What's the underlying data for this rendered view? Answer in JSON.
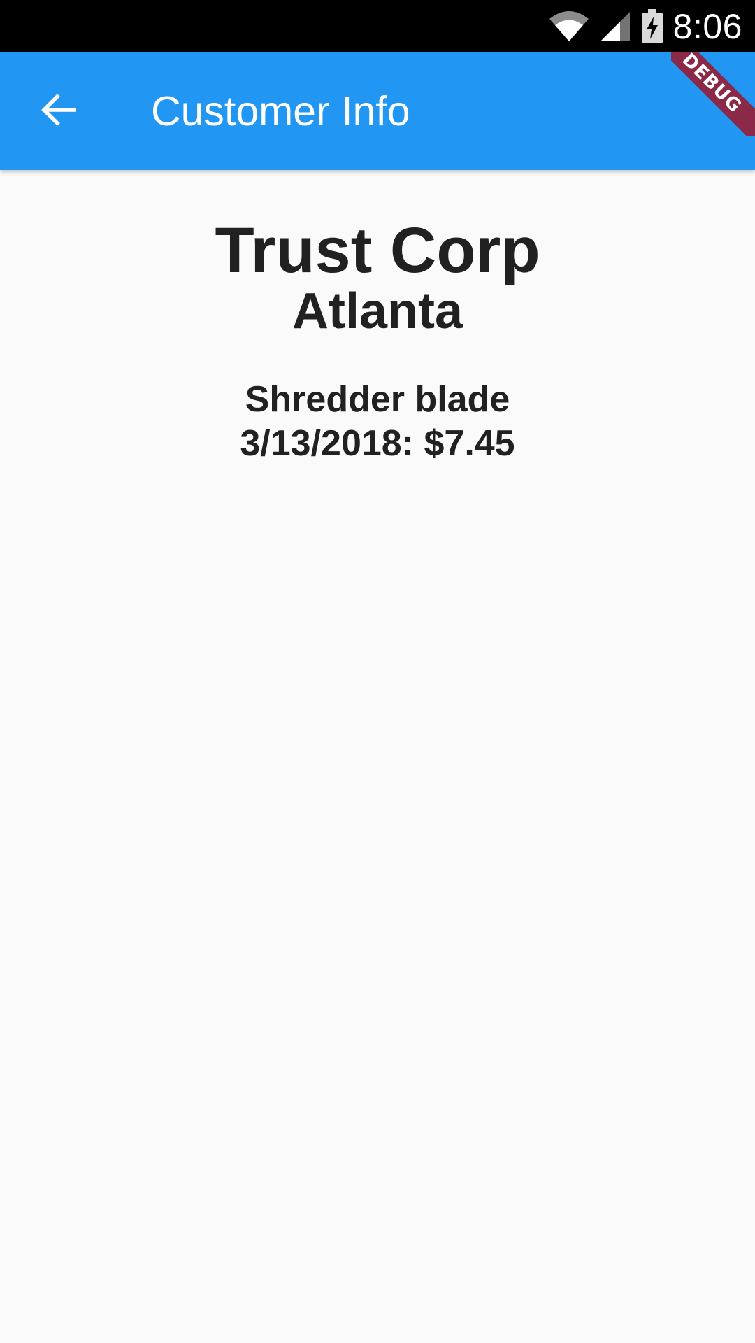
{
  "status_bar": {
    "time": "8:06",
    "icons": [
      "wifi-icon",
      "cell-signal-icon",
      "battery-charging-icon"
    ],
    "background": "#000000"
  },
  "app_bar": {
    "title": "Customer Info",
    "back_icon": "arrow-back-icon",
    "color": "#2196f3",
    "debug_banner": "DEBUG"
  },
  "customer": {
    "name": "Trust Corp",
    "city": "Atlanta"
  },
  "purchase": {
    "item": "Shredder blade",
    "date": "3/13/2018",
    "amount": "$7.45",
    "line": "3/13/2018: $7.45"
  }
}
